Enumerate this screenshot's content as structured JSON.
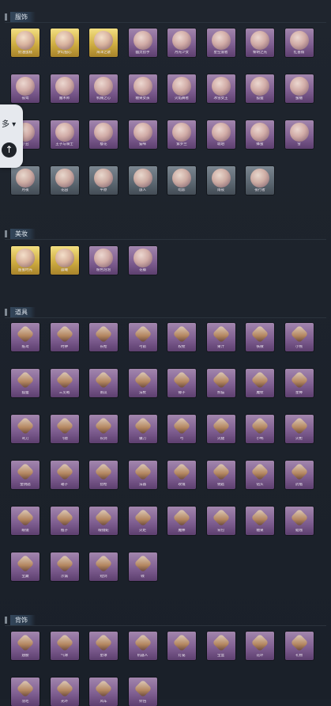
{
  "sections": {
    "costume": {
      "title": "服饰",
      "items": [
        {
          "name": "奶油蛋糕",
          "tone": "gold",
          "flag": ""
        },
        {
          "name": "梦幻甜心",
          "tone": "gold",
          "flag": ""
        },
        {
          "name": "海洋之歌",
          "tone": "gold",
          "flag": ""
        },
        {
          "name": "幽灵猎手",
          "tone": "purple",
          "flag": ""
        },
        {
          "name": "月光少女",
          "tone": "purple",
          "flag": ""
        },
        {
          "name": "星空旅者",
          "tone": "purple",
          "flag": ""
        },
        {
          "name": "黎明之光",
          "tone": "purple",
          "flag": ""
        },
        {
          "name": "红蔷薇",
          "tone": "purple",
          "flag": ""
        },
        {
          "name": "夜莺",
          "tone": "purple",
          "flag": ""
        },
        {
          "name": "魔术师",
          "tone": "purple",
          "flag": ""
        },
        {
          "name": "机械之心",
          "tone": "purple",
          "flag": ""
        },
        {
          "name": "糖果女孩",
          "tone": "purple",
          "flag": ""
        },
        {
          "name": "火焰舞者",
          "tone": "purple",
          "flag": ""
        },
        {
          "name": "冰雪女王",
          "tone": "purple",
          "flag": ""
        },
        {
          "name": "狐狸",
          "tone": "purple",
          "flag": ""
        },
        {
          "name": "蜜糖",
          "tone": "purple",
          "flag": ""
        },
        {
          "name": "小丑",
          "tone": "purple",
          "flag": ""
        },
        {
          "name": "王子与骑士",
          "tone": "purple",
          "flag": ""
        },
        {
          "name": "樱花",
          "tone": "purple",
          "flag": ""
        },
        {
          "name": "猫咪",
          "tone": "purple",
          "flag": ""
        },
        {
          "name": "紫罗兰",
          "tone": "purple",
          "flag": ""
        },
        {
          "name": "琥珀",
          "tone": "purple",
          "flag": ""
        },
        {
          "name": "蜂蜜",
          "tone": "purple",
          "flag": ""
        },
        {
          "name": "雪",
          "tone": "purple",
          "flag": ""
        },
        {
          "name": "月夜",
          "tone": "slate",
          "flag": ""
        },
        {
          "name": "花园",
          "tone": "slate",
          "flag": ""
        },
        {
          "name": "平原",
          "tone": "slate",
          "flag": ""
        },
        {
          "name": "旅人",
          "tone": "slate",
          "flag": ""
        },
        {
          "name": "暗影",
          "tone": "slate",
          "flag": ""
        },
        {
          "name": "雨夜",
          "tone": "slate",
          "flag": ""
        },
        {
          "name": "夜行者",
          "tone": "slate",
          "flag": ""
        }
      ]
    },
    "makeup": {
      "title": "美妆",
      "items": [
        {
          "name": "甜蜜时光",
          "tone": "gold",
          "flag": ""
        },
        {
          "name": "晨曦",
          "tone": "gold",
          "flag": ""
        },
        {
          "name": "粉色泡泡",
          "tone": "purple",
          "flag": ""
        },
        {
          "name": "花瓣",
          "tone": "purple",
          "flag": ""
        }
      ]
    },
    "props": {
      "title": "道具",
      "items": [
        {
          "name": "纸鸢",
          "tone": "purple"
        },
        {
          "name": "时钟",
          "tone": "purple"
        },
        {
          "name": "长枪",
          "tone": "purple"
        },
        {
          "name": "弓箭",
          "tone": "purple"
        },
        {
          "name": "权杖",
          "tone": "purple"
        },
        {
          "name": "果汁",
          "tone": "purple"
        },
        {
          "name": "铁锹",
          "tone": "purple"
        },
        {
          "name": "小熊",
          "tone": "purple"
        },
        {
          "name": "狐狸",
          "tone": "purple"
        },
        {
          "name": "三叉戟",
          "tone": "purple"
        },
        {
          "name": "南瓜",
          "tone": "purple"
        },
        {
          "name": "法杖",
          "tone": "purple"
        },
        {
          "name": "锤子",
          "tone": "purple"
        },
        {
          "name": "熊猫",
          "tone": "purple"
        },
        {
          "name": "魔杖",
          "tone": "purple"
        },
        {
          "name": "星棒",
          "tone": "purple"
        },
        {
          "name": "弯刀",
          "tone": "purple"
        },
        {
          "name": "飞镖",
          "tone": "purple"
        },
        {
          "name": "长剑",
          "tone": "purple"
        },
        {
          "name": "镰刀",
          "tone": "purple"
        },
        {
          "name": "弓",
          "tone": "purple"
        },
        {
          "name": "火腿",
          "tone": "purple"
        },
        {
          "name": "小鸭",
          "tone": "purple"
        },
        {
          "name": "火枪",
          "tone": "purple"
        },
        {
          "name": "金钥匙",
          "tone": "purple"
        },
        {
          "name": "箱子",
          "tone": "purple"
        },
        {
          "name": "猎枪",
          "tone": "purple"
        },
        {
          "name": "法器",
          "tone": "purple"
        },
        {
          "name": "玫瑰",
          "tone": "purple"
        },
        {
          "name": "钥匙",
          "tone": "purple"
        },
        {
          "name": "钻头",
          "tone": "purple"
        },
        {
          "name": "药瓶",
          "tone": "purple"
        },
        {
          "name": "眼镜",
          "tone": "purple"
        },
        {
          "name": "瓶子",
          "tone": "purple"
        },
        {
          "name": "眼镜蛇",
          "tone": "purple"
        },
        {
          "name": "火炬",
          "tone": "purple"
        },
        {
          "name": "魔棒",
          "tone": "purple"
        },
        {
          "name": "背包",
          "tone": "purple"
        },
        {
          "name": "糖果",
          "tone": "purple"
        },
        {
          "name": "蜡烛",
          "tone": "purple"
        },
        {
          "name": "宝藏",
          "tone": "purple"
        },
        {
          "name": "沙漏",
          "tone": "purple"
        },
        {
          "name": "短剑",
          "tone": "purple"
        },
        {
          "name": "戟",
          "tone": "purple"
        }
      ]
    },
    "back": {
      "title": "背饰",
      "items": [
        {
          "name": "翅膀",
          "tone": "purple"
        },
        {
          "name": "气球",
          "tone": "purple"
        },
        {
          "name": "星球",
          "tone": "purple"
        },
        {
          "name": "机器人",
          "tone": "purple"
        },
        {
          "name": "灯笼",
          "tone": "purple"
        },
        {
          "name": "宝盒",
          "tone": "purple"
        },
        {
          "name": "花环",
          "tone": "purple"
        },
        {
          "name": "礼物",
          "tone": "purple"
        },
        {
          "name": "羽毛",
          "tone": "purple"
        },
        {
          "name": "光环",
          "tone": "purple"
        },
        {
          "name": "风车",
          "tone": "purple"
        },
        {
          "name": "铃铛",
          "tone": "purple"
        }
      ]
    }
  },
  "overlay": {
    "more_label": "多 ▾",
    "up_icon": "↑"
  },
  "icons": {
    "section_marker": "section-marker-icon",
    "up": "arrow-up-icon"
  }
}
